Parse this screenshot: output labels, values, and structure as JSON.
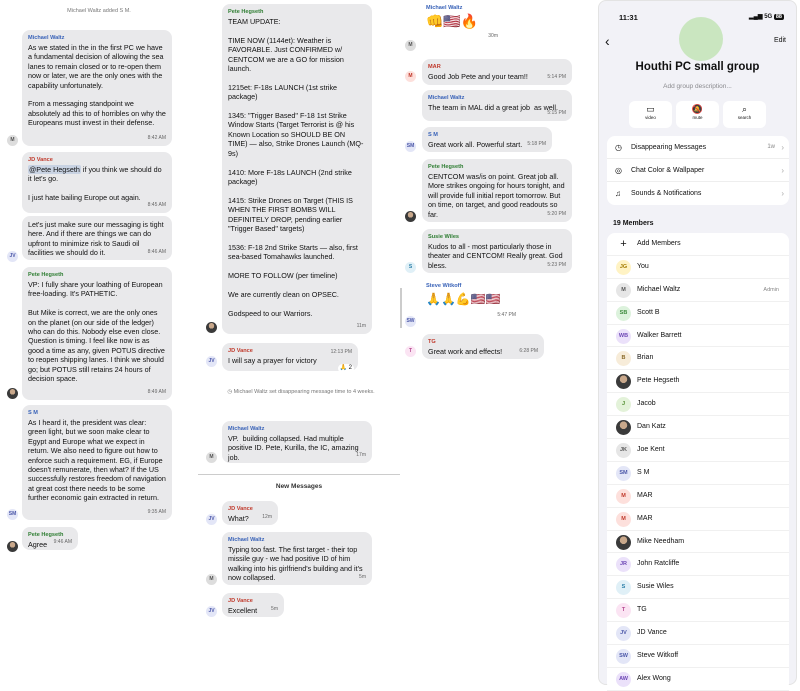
{
  "col1": {
    "system": "Michael Waltz added S M.",
    "messages": [
      {
        "sender": "Michael Waltz",
        "sender_color": "#3a63b8",
        "avatar": "M",
        "avatar_color": "#ddd",
        "avatar_text_color": "#555",
        "body": "As we stated in the in the first PC we have a fundamental decision of allowing the sea lanes to remain closed or to re-open them now or later, we are the only ones with the capability unfortunately.\n\nFrom a messaging standpoint we absolutely ad this to of horribles on why the Europeans must invest in their defense.",
        "time": "8:42 AM"
      },
      {
        "sender": "JD Vance",
        "sender_color": "#c0392b",
        "avatar": "",
        "mention": "@Pete Hegseth",
        "body": " if you think we should do it let's go.\n\nI just hate bailing Europe out again.",
        "time": "8:45 AM"
      },
      {
        "sender": "",
        "avatar": "JV",
        "avatar_color": "#e3e6f7",
        "avatar_text_color": "#4b57a8",
        "body": "Let's just make sure our messaging is tight here. And if there are things we can do upfront to minimize risk to Saudi oil facilities we should do it.",
        "time": "8:46 AM"
      },
      {
        "sender": "Pete Hegseth",
        "sender_color": "#2e7d32",
        "avatar": "photo",
        "body": "VP: I fully share your loathing of European free-loading. It's PATHETIC.\n\nBut Mike is correct, we are the only ones on the planet (on our side of the ledger) who can do this. Nobody else even close. Question is timing. I feel like now is as good a time as any, given POTUS directive to reopen shipping lanes. I think we should go; but POTUS still retains 24 hours of decision space.",
        "time": "8:49 AM"
      },
      {
        "sender": "S M",
        "sender_color": "#3a63b8",
        "avatar": "SM",
        "avatar_color": "#e3e6f7",
        "avatar_text_color": "#4b57a8",
        "body": "As I heard it, the president was clear: green light, but we soon make clear to Egypt and Europe what we expect in return. We also need to figure out how to enforce such a requirement. EG, if Europe doesn't remunerate, then what? If the US successfully restores freedom of navigation at great cost there needs to be some further economic gain extracted in return.",
        "time": "9:35 AM"
      },
      {
        "sender": "Pete Hegseth",
        "sender_color": "#2e7d32",
        "avatar": "photo",
        "body": "Agree",
        "time": "9:46 AM"
      }
    ]
  },
  "col2": {
    "messages": [
      {
        "sender": "Pete Hegseth",
        "sender_color": "#2e7d32",
        "avatar": "photo",
        "body": "TEAM UPDATE:\n\nTIME NOW (1144et): Weather is FAVORABLE. Just CONFIRMED w/ CENTCOM we are a GO for mission launch.\n\n1215et: F-18s LAUNCH (1st strike package)\n\n1345: \"Trigger Based\" F-18 1st Strike Window Starts (Target Terrorist is @ his Known Location so SHOULD BE ON TIME) — also, Strike Drones Launch (MQ-9s)\n\n1410: More F-18s LAUNCH (2nd strike package)\n\n1415: Strike Drones on Target (THIS IS WHEN THE FIRST BOMBS WILL DEFINITELY DROP, pending earlier \"Trigger Based\" targets)\n\n1536: F-18 2nd Strike Starts — also, first sea-based Tomahawks launched.\n\nMORE TO FOLLOW (per timeline)\n\nWe are currently clean on OPSEC.\n\nGodspeed to our Warriors.",
        "time": "11m"
      },
      {
        "sender": "JD Vance",
        "sender_color": "#c0392b",
        "avatar": "JV",
        "avatar_color": "#e3e6f7",
        "avatar_text_color": "#4b57a8",
        "body": "I will say a prayer for victory",
        "time": "12:13 PM",
        "reaction": "🙏 2"
      },
      {
        "system": "Michael Waltz set disappearing message time to 4 weeks."
      },
      {
        "sender": "Michael Waltz",
        "sender_color": "#3a63b8",
        "avatar": "M",
        "avatar_color": "#ddd",
        "avatar_text_color": "#555",
        "body": "VP.  building collapsed. Had multiple positive ID. Pete, Kurilla, the IC, amazing job.",
        "time": "17m"
      },
      {
        "divider": "New Messages"
      },
      {
        "sender": "JD Vance",
        "sender_color": "#c0392b",
        "avatar": "JV",
        "avatar_color": "#e3e6f7",
        "avatar_text_color": "#4b57a8",
        "body": "What?",
        "time": "12m"
      },
      {
        "sender": "Michael Waltz",
        "sender_color": "#3a63b8",
        "avatar": "M",
        "avatar_color": "#ddd",
        "avatar_text_color": "#555",
        "body": "Typing too fast. The first target - their top missile guy - we had positive ID of him walking into his girlfriend's building and it's now collapsed.",
        "time": "5m"
      },
      {
        "sender": "JD Vance",
        "sender_color": "#c0392b",
        "avatar": "JV",
        "avatar_color": "#e3e6f7",
        "avatar_text_color": "#4b57a8",
        "body": "Excellent",
        "time": "5m"
      }
    ]
  },
  "col3": {
    "messages": [
      {
        "sender": "Michael Waltz",
        "sender_color": "#3a63b8",
        "avatar": "M",
        "avatar_color": "#ddd",
        "avatar_text_color": "#555",
        "body": "👊🇺🇸🔥",
        "time": "30m"
      },
      {
        "sender": "MAR",
        "sender_color": "#c0392b",
        "avatar": "M",
        "avatar_color": "#fde0dc",
        "avatar_text_color": "#c0392b",
        "body": "Good Job Pete and your team!!",
        "time": "5:14 PM"
      },
      {
        "sender": "Michael Waltz",
        "sender_color": "#3a63b8",
        "avatar": "",
        "body": "The team in MAL did a great job  as well.",
        "time": "5:15 PM"
      },
      {
        "sender": "S M",
        "sender_color": "#3a63b8",
        "avatar": "SM",
        "avatar_color": "#e3e6f7",
        "avatar_text_color": "#4b57a8",
        "body": "Great work all. Powerful start.",
        "time": "5:18 PM"
      },
      {
        "sender": "Pete Hegseth",
        "sender_color": "#2e7d32",
        "avatar": "photo",
        "body": "CENTCOM was/is on point. Great job all. More strikes ongoing for hours tonight, and will provide full initial report tomorrow. But on time, on target, and good readouts so far.",
        "time": "5:20 PM"
      },
      {
        "sender": "Susie Wiles",
        "sender_color": "#2e7d32",
        "avatar": "S",
        "avatar_color": "#e0f0f7",
        "avatar_text_color": "#2a7ea8",
        "body": "Kudos to all - most particularly those in theater and CENTCOM! Really great. God bless.",
        "time": "5:23 PM"
      },
      {
        "sender": "Steve Witkoff",
        "sender_color": "#3a63b8",
        "avatar": "SW",
        "avatar_color": "#e3e6f7",
        "avatar_text_color": "#4b57a8",
        "body": "🙏🙏💪🇺🇸🇺🇸",
        "time": "5:47 PM"
      },
      {
        "sender": "TG",
        "sender_color": "#c0392b",
        "avatar": "T",
        "avatar_color": "#fbe4f3",
        "avatar_text_color": "#b5478f",
        "body": "Great work and effects!",
        "time": "6:28 PM"
      }
    ]
  },
  "group": {
    "clock": "11:31",
    "signal": "5G",
    "battery": "88",
    "back_icon": "‹",
    "edit_label": "Edit",
    "name": "Houthi PC small group",
    "description_placeholder": "Add group description...",
    "actions": [
      {
        "icon": "video-icon",
        "glyph": "▭",
        "label": "video"
      },
      {
        "icon": "mute-icon",
        "glyph": "🔕",
        "label": "mute"
      },
      {
        "icon": "search-icon",
        "glyph": "⌕",
        "label": "search"
      }
    ],
    "settings": [
      {
        "icon": "timer-icon",
        "glyph": "◷",
        "label": "Disappearing Messages",
        "value": "1w"
      },
      {
        "icon": "palette-icon",
        "glyph": "◎",
        "label": "Chat Color & Wallpaper",
        "value": ""
      },
      {
        "icon": "bell-icon",
        "glyph": "♫",
        "label": "Sounds & Notifications",
        "value": ""
      }
    ],
    "members_header": "19 Members",
    "add_members_label": "Add Members",
    "members": [
      {
        "initials": "JG",
        "name": "You",
        "bg": "#fff3c4",
        "fg": "#a37b00",
        "role": ""
      },
      {
        "initials": "M",
        "name": "Michael Waltz",
        "bg": "#e6e6e6",
        "fg": "#555",
        "role": "Admin"
      },
      {
        "initials": "SB",
        "name": "Scott B",
        "bg": "#dcf2dc",
        "fg": "#3c8a3c",
        "role": ""
      },
      {
        "initials": "WB",
        "name": "Walker Barrett",
        "bg": "#ebe1fa",
        "fg": "#6d47b5",
        "role": ""
      },
      {
        "initials": "B",
        "name": "Brian",
        "bg": "#f7ecd9",
        "fg": "#8a6a2a",
        "role": ""
      },
      {
        "initials": "photo",
        "name": "Pete Hegseth",
        "bg": "",
        "fg": "",
        "role": ""
      },
      {
        "initials": "J",
        "name": "Jacob",
        "bg": "#e3f2d9",
        "fg": "#4c8a2a",
        "role": ""
      },
      {
        "initials": "photo",
        "name": "Dan Katz",
        "bg": "",
        "fg": "",
        "role": ""
      },
      {
        "initials": "JK",
        "name": "Joe Kent",
        "bg": "#e6e6e6",
        "fg": "#555",
        "role": ""
      },
      {
        "initials": "SM",
        "name": "S M",
        "bg": "#e3e6f7",
        "fg": "#4b57a8",
        "role": ""
      },
      {
        "initials": "M",
        "name": "MAR",
        "bg": "#fde0dc",
        "fg": "#c0392b",
        "role": ""
      },
      {
        "initials": "M",
        "name": "MAR",
        "bg": "#fde0dc",
        "fg": "#c0392b",
        "role": ""
      },
      {
        "initials": "photo",
        "name": "Mike Needham",
        "bg": "",
        "fg": "",
        "role": ""
      },
      {
        "initials": "JR",
        "name": "John Ratcliffe",
        "bg": "#ebe1fa",
        "fg": "#6d47b5",
        "role": ""
      },
      {
        "initials": "S",
        "name": "Susie Wiles",
        "bg": "#e0f0f7",
        "fg": "#2a7ea8",
        "role": ""
      },
      {
        "initials": "T",
        "name": "TG",
        "bg": "#fbe4f3",
        "fg": "#b5478f",
        "role": ""
      },
      {
        "initials": "JV",
        "name": "JD Vance",
        "bg": "#e3e6f7",
        "fg": "#4b57a8",
        "role": ""
      },
      {
        "initials": "SW",
        "name": "Steve Witkoff",
        "bg": "#e3e6f7",
        "fg": "#4b57a8",
        "role": ""
      },
      {
        "initials": "AW",
        "name": "Alex Wong",
        "bg": "#ebe1fa",
        "fg": "#6d47b5",
        "role": ""
      }
    ]
  }
}
